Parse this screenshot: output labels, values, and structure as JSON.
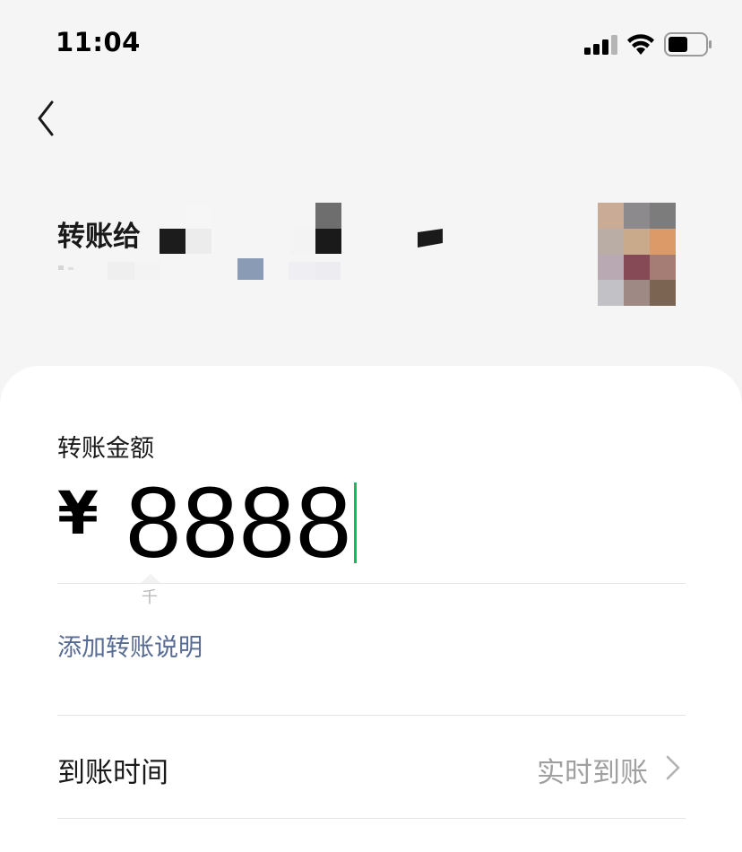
{
  "status_bar": {
    "time": "11:04",
    "icons": [
      "cellular-signal-icon",
      "wifi-icon",
      "battery-icon"
    ]
  },
  "nav": {
    "back_icon": "chevron-left-icon"
  },
  "recipient": {
    "label": "转账给",
    "name": "[pixelated]",
    "account": "[pixelated]",
    "avatar": "pixelated-avatar"
  },
  "transfer": {
    "amount_label": "转账金额",
    "currency_symbol": "¥",
    "amount_value": "8888",
    "unit_hint": "千",
    "add_note_label": "添加转账说明"
  },
  "arrival": {
    "label": "到账时间",
    "value": "实时到账"
  },
  "colors": {
    "accent_green": "#07c160",
    "link_blue": "#576b95",
    "background": "#f5f5f5",
    "card": "#ffffff",
    "muted_text": "#a0a0a0"
  }
}
